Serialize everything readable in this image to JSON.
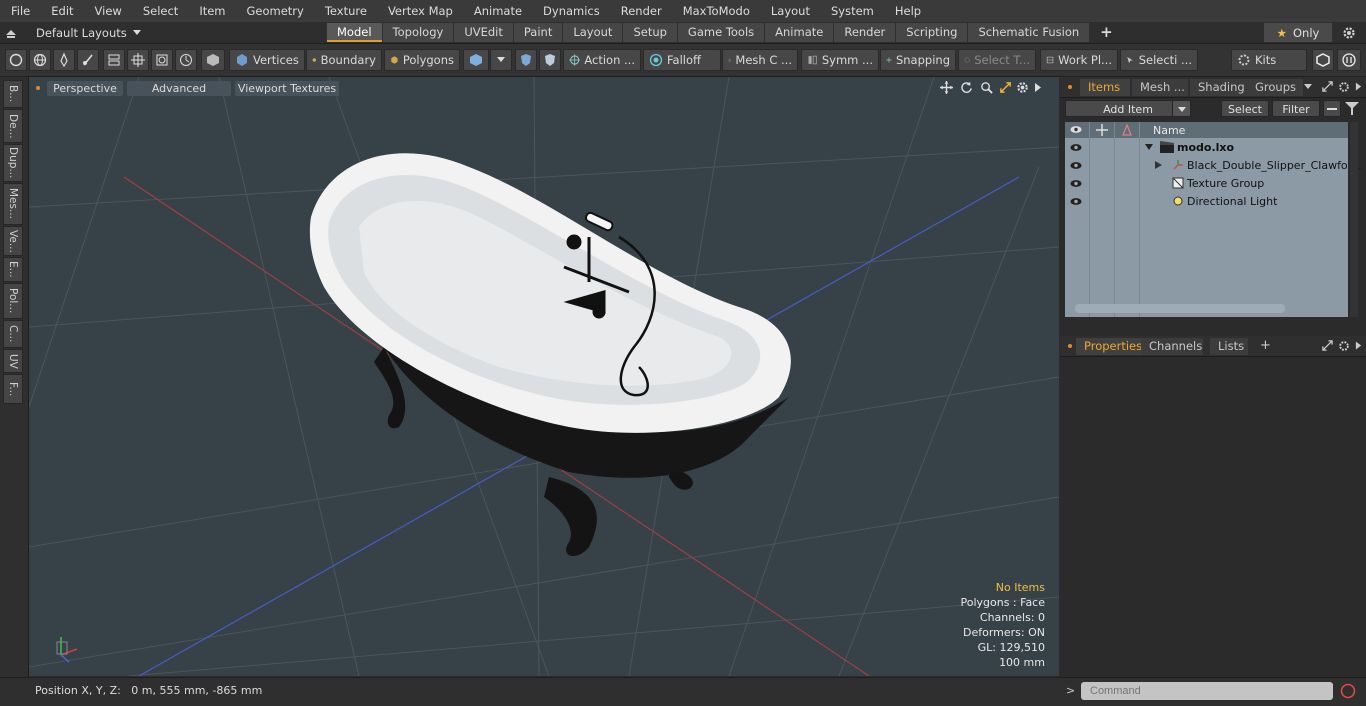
{
  "menu": [
    "File",
    "Edit",
    "View",
    "Select",
    "Item",
    "Geometry",
    "Texture",
    "Vertex Map",
    "Animate",
    "Dynamics",
    "Render",
    "MaxToModo",
    "Layout",
    "System",
    "Help"
  ],
  "layouts": {
    "label": "Default Layouts"
  },
  "tabs": [
    "Model",
    "Topology",
    "UVEdit",
    "Paint",
    "Layout",
    "Setup",
    "Game Tools",
    "Animate",
    "Render",
    "Scripting",
    "Schematic Fusion"
  ],
  "tabs_add": "+",
  "only_button": "Only",
  "toolbar": {
    "vertices": "Vertices",
    "boundary": "Boundary",
    "polygons": "Polygons",
    "action": "Action ...",
    "falloff": "Falloff",
    "mesh": "Mesh C ...",
    "symm": "Symm ...",
    "snapping": "Snapping",
    "select_t": "Select T...",
    "work_pl": "Work Pl...",
    "selecti": "Selecti ...",
    "kits": "Kits"
  },
  "left_tabs": [
    "B...",
    "De...",
    "Dup...",
    "Mes...",
    "Ve...",
    "E...",
    "Pol...",
    "C...",
    "UV",
    "F..."
  ],
  "viewport": {
    "perspective": "Perspective",
    "advanced": "Advanced",
    "textures": "Viewport Textures",
    "hud": {
      "no_items": "No Items",
      "polygons": "Polygons : Face",
      "channels": "Channels: 0",
      "deformers": "Deformers: ON",
      "gl": "GL: 129,510",
      "scale": "100 mm"
    }
  },
  "items_panel": {
    "tabs": [
      "Items",
      "Mesh ...",
      "Shading",
      "Groups"
    ],
    "add_item": "Add Item",
    "select": "Select",
    "filter": "Filter",
    "name_header": "Name",
    "rows": [
      "modo.lxo",
      "Black_Double_Slipper_Clawfo ...",
      "Texture Group",
      "Directional Light"
    ]
  },
  "props_panel": {
    "tabs": [
      "Properties",
      "Channels",
      "Lists"
    ],
    "add": "+"
  },
  "status": {
    "position": "Position X, Y, Z:   0 m, 555 mm, -865 mm",
    "command_placeholder": "Command",
    "prompt": ">"
  },
  "colors": {
    "accent": "#f0a630",
    "viewport_bg": "#364148",
    "list_bg": "#8b9aa4"
  }
}
